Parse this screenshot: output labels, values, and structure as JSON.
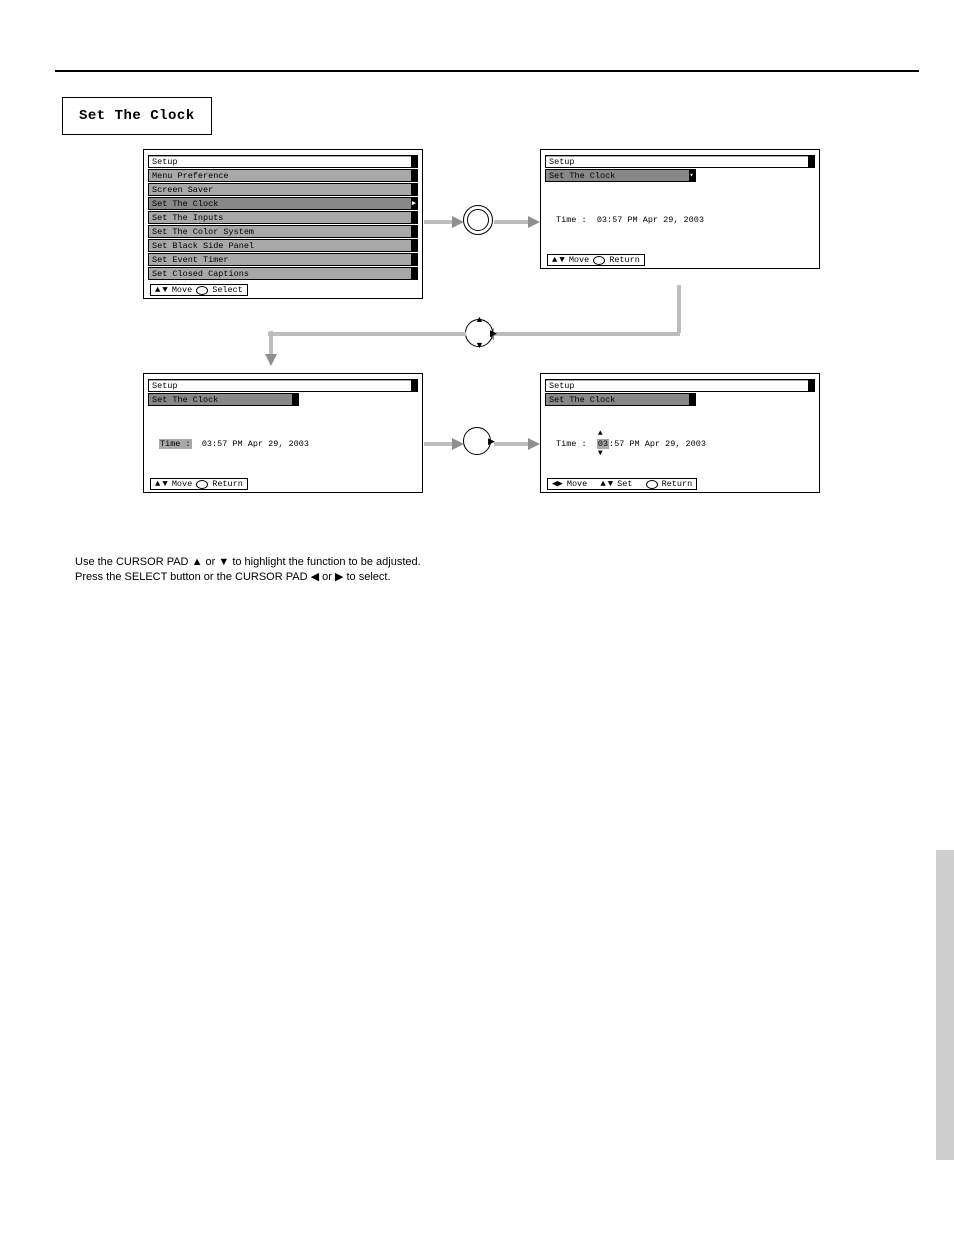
{
  "heading": "Set The Clock",
  "panelA": {
    "title": "Setup",
    "items": [
      "Menu Preference",
      "Screen Saver",
      "Set The Clock",
      "Set The Inputs",
      "Set The Color System",
      "Set Black Side Panel",
      "Set Event Timer",
      "Set Closed Captions"
    ],
    "hint_move": "Move",
    "hint_select": "Select"
  },
  "panelB": {
    "title": "Setup",
    "subtitle": "Set The Clock",
    "time_label": "Time :",
    "time_value": "03:57 PM Apr 29, 2003",
    "hint_move": "Move",
    "hint_return": "Return"
  },
  "panelC": {
    "title": "Setup",
    "subtitle": "Set The Clock",
    "time_label": "Time :",
    "time_value": "03:57 PM Apr 29, 2003",
    "hint_move": "Move",
    "hint_return": "Return"
  },
  "panelD": {
    "title": "Setup",
    "subtitle": "Set The Clock",
    "time_label": "Time :",
    "time_value": "03:57 PM Apr 29, 2003",
    "hint_move": "Move",
    "hint_set": "Set",
    "hint_return": "Return"
  },
  "instructions": {
    "line1_a": "Use the CURSOR PAD ",
    "line1_b": " or ",
    "line1_c": " to highlight the function to be adjusted.",
    "line2_a": "Press the SELECT button or the CURSOR PAD ",
    "line2_b": " to select."
  },
  "chart_data": {
    "type": "diagram",
    "nodes": [
      {
        "id": "A",
        "label": "Setup menu (list)",
        "position": "top-left"
      },
      {
        "id": "B",
        "label": "Set The Clock — Time display",
        "position": "top-right"
      },
      {
        "id": "C",
        "label": "Set The Clock — Time (label highlighted)",
        "position": "bottom-left"
      },
      {
        "id": "D",
        "label": "Set The Clock — hour field selected (arrows)",
        "position": "bottom-right"
      }
    ],
    "edges": [
      {
        "from": "A",
        "to": "B",
        "via": "SELECT (round dial, press)",
        "dir": "right"
      },
      {
        "from": "B",
        "to": "D",
        "via": "down-flow",
        "dir": "down"
      },
      {
        "from": "D",
        "to": "C",
        "via": "CURSOR up/down/right",
        "dir": "left"
      },
      {
        "from": "C",
        "to": "D",
        "via": "CURSOR right",
        "dir": "right"
      }
    ],
    "time_value": "03:57 PM Apr 29, 2003"
  }
}
